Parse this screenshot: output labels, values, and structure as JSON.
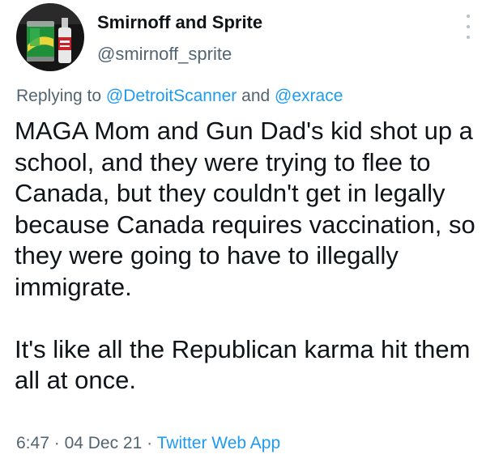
{
  "tweet": {
    "author": {
      "display_name": "Smirnoff and Sprite",
      "handle": "@smirnoff_sprite",
      "avatar_icon": "can-and-bottle-avatar"
    },
    "reply": {
      "prefix": "Replying to",
      "mention_1": "@DetroitScanner",
      "conjunction": "and",
      "mention_2": "@exrace"
    },
    "text_paragraphs": [
      "MAGA Mom and Gun Dad's kid shot up a school, and they were trying to flee to Canada, but they couldn't get in legally because Canada requires vaccination, so they were going to have to illegally immigrate.",
      "It's like all the Republican karma hit them all at once."
    ],
    "time": "6:47",
    "date": "04 Dec 21",
    "separator": "·",
    "source": "Twitter Web App"
  },
  "colors": {
    "text": "#0f1419",
    "secondary": "#536471",
    "link": "#1d9bf0",
    "background": "#ffffff"
  }
}
